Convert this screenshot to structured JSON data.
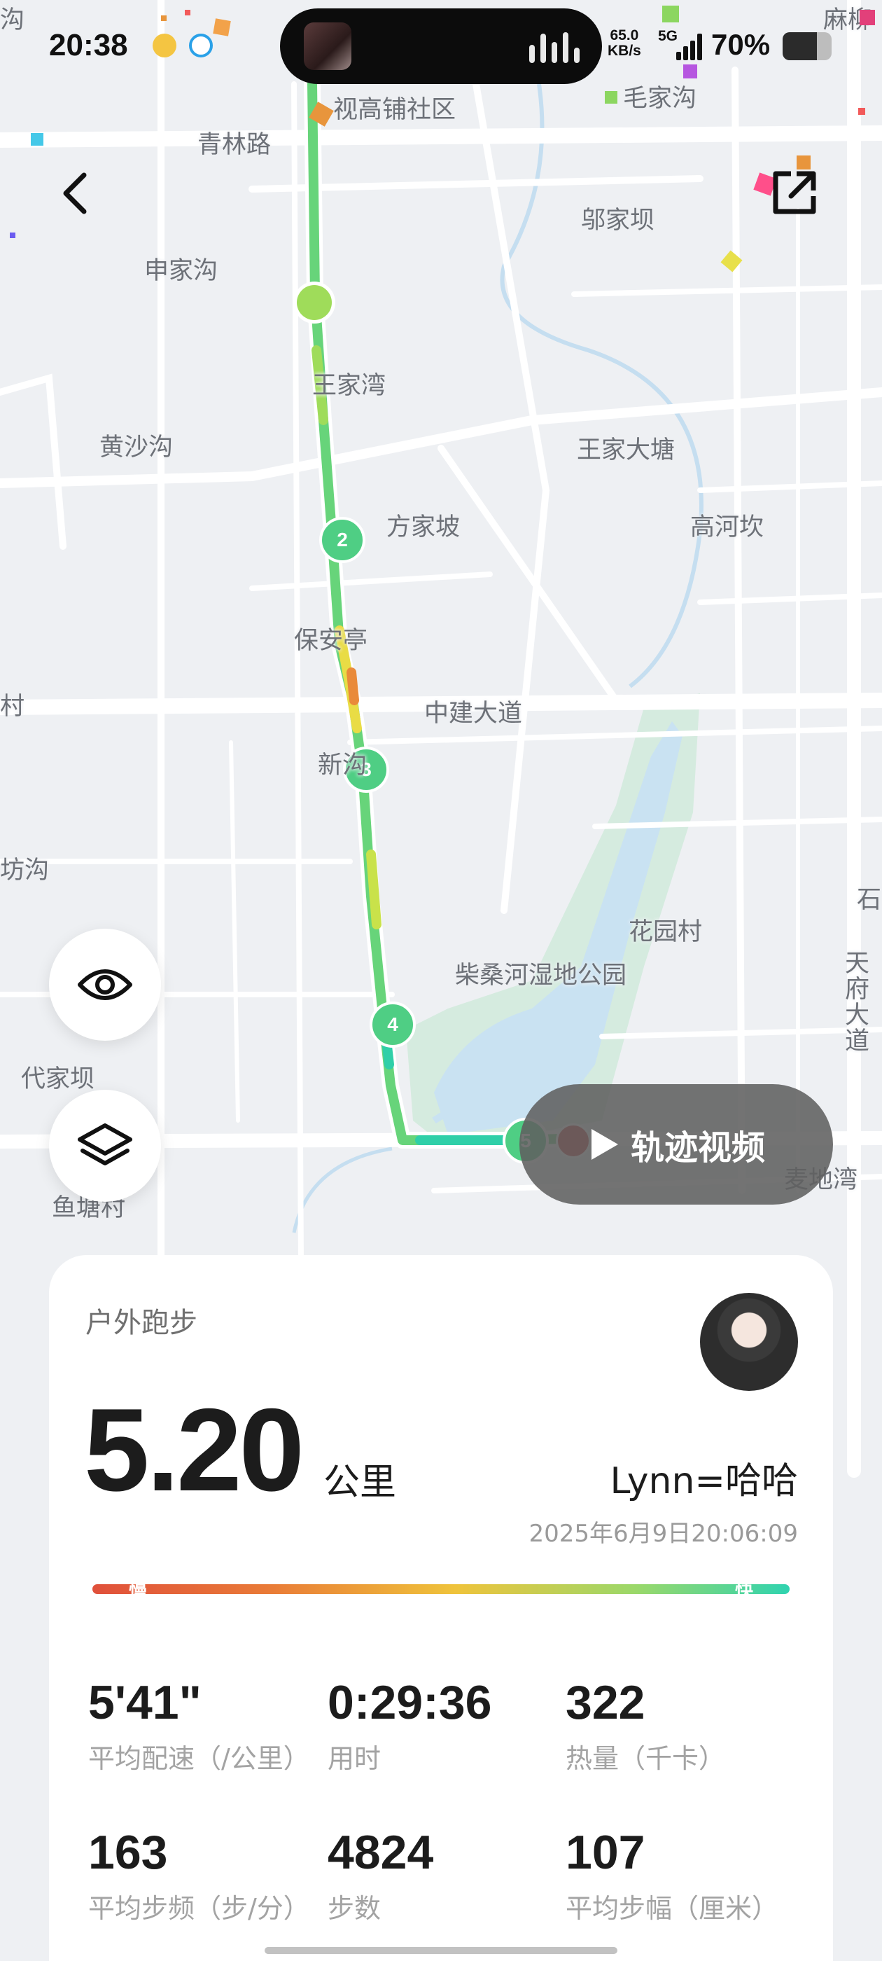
{
  "status_bar": {
    "time": "20:38",
    "net_speed_value": "65.0",
    "net_speed_unit": "KB/s",
    "network_type": "5G",
    "battery_percent": "70%",
    "battery_level": 0.7
  },
  "map": {
    "labels": [
      "视高铺社区",
      "毛家沟",
      "青林路",
      "邬家坝",
      "申家沟",
      "王家湾",
      "黄沙沟",
      "王家大塘",
      "方家坡",
      "高河坎",
      "保安亭",
      "中建大道",
      "新沟",
      "花园村",
      "柴桑河湿地公园",
      "天府大道",
      "代家坝",
      "鱼塘村",
      "麦地湾",
      "坊沟",
      "村",
      "石",
      "麻柳",
      "沟"
    ],
    "route_markers": [
      "2",
      "3",
      "4",
      "5"
    ],
    "colors": {
      "route_fast": "#5fd27a",
      "route_mid": "#e9dc45",
      "route_slow": "#e98a3a",
      "marker": "#4fce84",
      "finish": "#c62828",
      "water": "#c9e2f2",
      "park": "#d5ebdf"
    }
  },
  "controls": {
    "back_icon": "chevron-left-icon",
    "share_icon": "external-link-icon",
    "eye_icon": "eye-icon",
    "layers_icon": "layers-icon",
    "video_label": "轨迹视频"
  },
  "workout": {
    "type": "户外跑步",
    "distance": "5.20",
    "distance_unit": "公里",
    "user_name": "Lynn=哈哈",
    "date": "2025年6月9日20:06:09",
    "pace_slow_label": "慢",
    "pace_fast_label": "快",
    "stats": [
      {
        "value": "5'41\"",
        "label": "平均配速（/公里）"
      },
      {
        "value": "0:29:36",
        "label": "用时"
      },
      {
        "value": "322",
        "label": "热量（千卡）"
      },
      {
        "value": "163",
        "label": "平均步频（步/分）"
      },
      {
        "value": "4824",
        "label": "步数"
      },
      {
        "value": "107",
        "label": "平均步幅（厘米）"
      }
    ]
  }
}
